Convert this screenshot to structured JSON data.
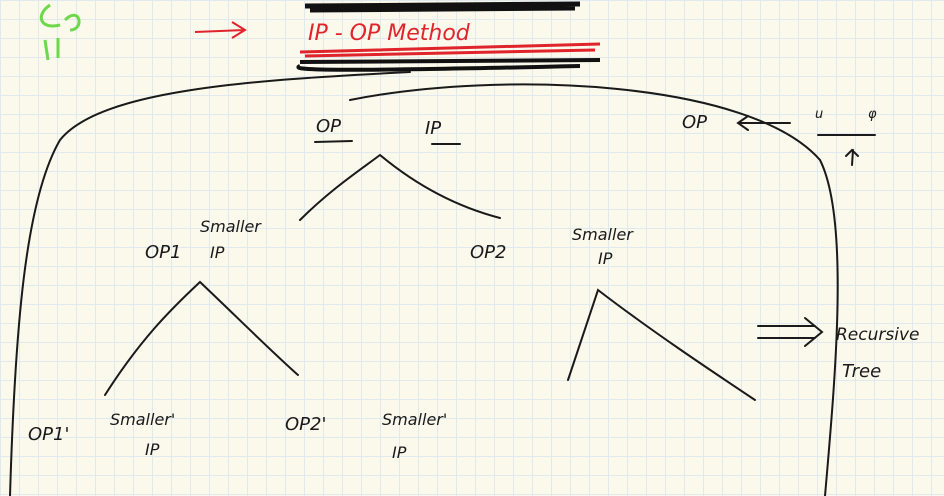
{
  "colors": {
    "ink": "#1a1a1a",
    "red": "#e0242c",
    "green": "#6cd84a",
    "grid": "#dfe9ee",
    "paper": "#fbf8ec"
  },
  "title": "IP - OP Method",
  "root": {
    "op": "OP",
    "ip": "IP"
  },
  "side_note": {
    "op": "OP",
    "u": "u",
    "phi": "φ"
  },
  "level1": {
    "op1": "OP1",
    "smaller_ip_1": [
      "Smaller",
      "IP"
    ],
    "op2": "OP2",
    "smaller_ip_2": [
      "Smaller",
      "IP"
    ]
  },
  "level2": {
    "op1p": "OP1'",
    "smaller_ip_1p": [
      "Smaller'",
      "IP"
    ],
    "op2p": "OP2'",
    "smaller_ip_2p": [
      "Smaller'",
      "IP"
    ]
  },
  "result": [
    "Recursive",
    "Tree"
  ]
}
